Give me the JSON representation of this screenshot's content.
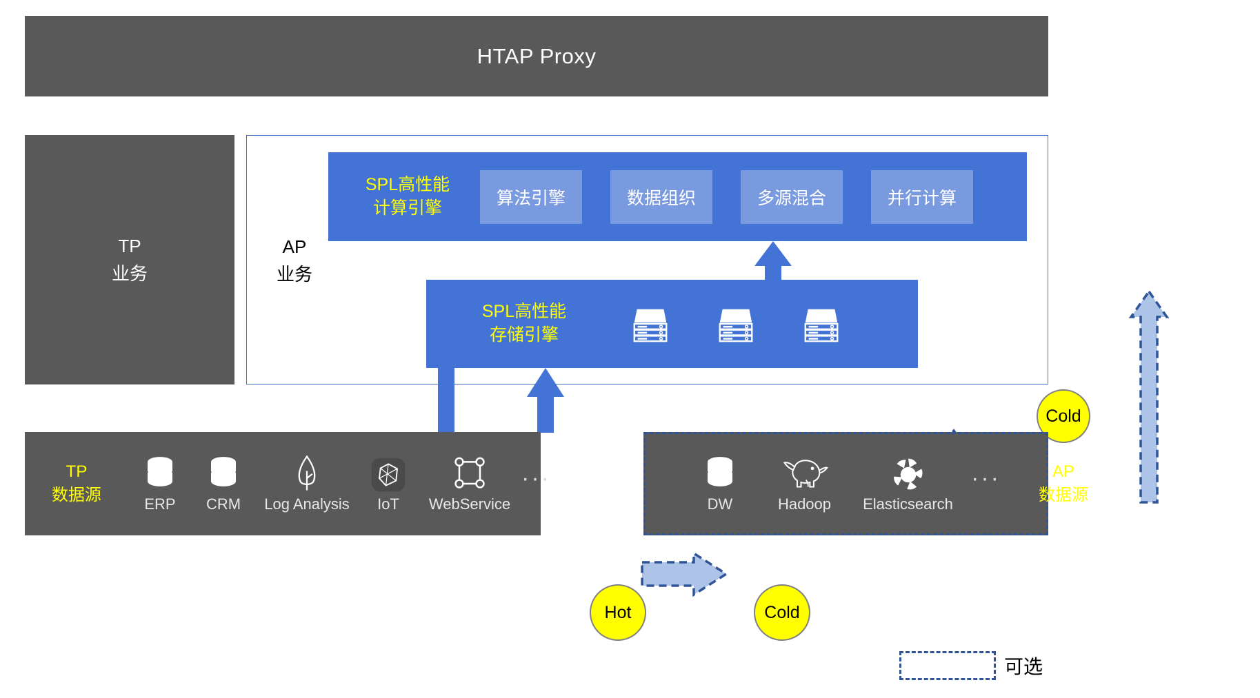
{
  "colors": {
    "gray_box": "#595959",
    "blue_primary": "#4273d5",
    "blue_chip": "#7a9ae0",
    "accent_yellow": "#ffff00",
    "dashed_blue": "#2f5597",
    "light_blue_arrow": "#aec3e8",
    "white": "#ffffff"
  },
  "header": {
    "title": "HTAP Proxy"
  },
  "tp_business": {
    "line1": "TP",
    "line2": "业务"
  },
  "ap_business": {
    "line1": "AP",
    "line2": "业务"
  },
  "compute_engine": {
    "title_line1": "SPL高性能",
    "title_line2": "计算引擎",
    "features": [
      {
        "label": "算法引擎"
      },
      {
        "label": "数据组织"
      },
      {
        "label": "多源混合"
      },
      {
        "label": "并行计算"
      }
    ]
  },
  "storage_engine": {
    "title_line1": "SPL高性能",
    "title_line2": "存储引擎",
    "nodes": [
      {
        "icon": "server-icon"
      },
      {
        "icon": "server-icon"
      },
      {
        "icon": "server-icon"
      }
    ],
    "badge": "Cold"
  },
  "tp_datasource": {
    "title_line1": "TP",
    "title_line2": "数据源",
    "items": [
      {
        "icon": "database-icon",
        "label": "ERP"
      },
      {
        "icon": "database-icon",
        "label": "CRM"
      },
      {
        "icon": "leaf-icon",
        "label": "Log Analysis"
      },
      {
        "icon": "iot-polygon-icon",
        "label": "IoT"
      },
      {
        "icon": "webservice-nodes-icon",
        "label": "WebService"
      }
    ],
    "ellipsis": "···",
    "badge": "Hot"
  },
  "ap_datasource": {
    "title_line1": "AP",
    "title_line2": "数据源",
    "items": [
      {
        "icon": "database-icon",
        "label": "DW"
      },
      {
        "icon": "hadoop-elephant-icon",
        "label": "Hadoop"
      },
      {
        "icon": "elasticsearch-icon",
        "label": "Elasticsearch"
      }
    ],
    "ellipsis": "···",
    "badge": "Cold"
  },
  "legend": {
    "label": "可选"
  }
}
